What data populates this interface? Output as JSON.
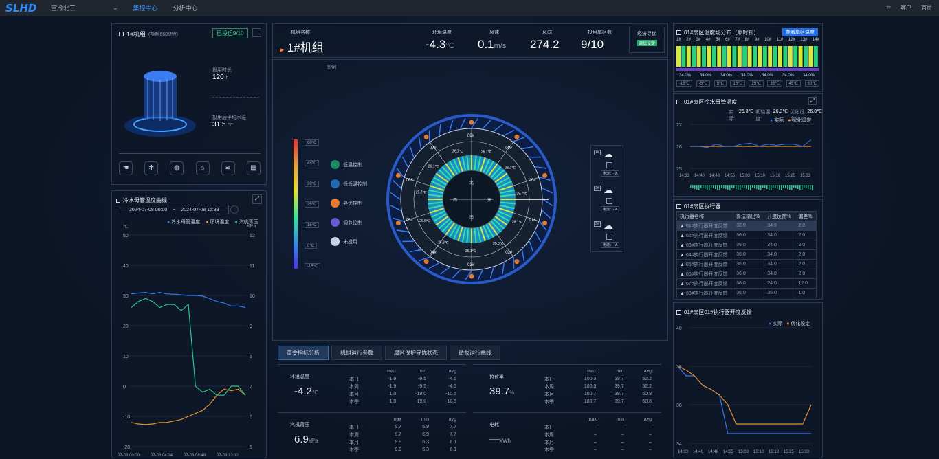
{
  "topbar": {
    "logo": "SLHD",
    "system": "空冷北三",
    "nav": [
      "集控中心",
      "分析中心"
    ],
    "right": [
      "客户",
      "首页"
    ]
  },
  "unit": {
    "title": "1#机组",
    "subtitle": "(额额660MW)",
    "status": "已投运9/10",
    "run_hours_label": "投用时长",
    "run_hours": "120",
    "run_hours_unit": "h",
    "avg_temp_label": "投用后平均水温",
    "avg_temp": "31.5",
    "avg_temp_unit": "℃"
  },
  "curve": {
    "title": "冷水母管温度曲线",
    "date_start": "2024-07-08 00:00",
    "date_sep": "~",
    "date_end": "2024-07-08 15:33",
    "legend": [
      "冷水母管温度",
      "环境温度",
      "汽机背压"
    ],
    "unit_left": "℃",
    "unit_right": "KPa",
    "x_ticks": [
      "07-08 00:00",
      "07-08 04:24",
      "07-08 08:48",
      "07-08 13:12"
    ]
  },
  "header": {
    "name_label": "机组名称",
    "name": "1#机组",
    "env_label": "环境温度",
    "env": "-4.3",
    "env_unit": "℃",
    "wind_label": "风速",
    "wind": "0.1",
    "wind_unit": "m/s",
    "dir_label": "风向",
    "dir": "274.2",
    "fans_label": "投用扇区数",
    "fans": "9/10",
    "opt_label": "经济寻优",
    "opt_btn": "调优设定",
    "legend_label": "图例"
  },
  "scale": [
    "60℃",
    "45℃",
    "30℃",
    "25℃",
    "15℃",
    "0℃",
    "-15℃"
  ],
  "modes": [
    "低温控制",
    "低低温控制",
    "寻优控制",
    "调节控制",
    "未投用"
  ],
  "ring": {
    "sectors": [
      "08#",
      "07#",
      "06#",
      "05#",
      "04#",
      "03#",
      "02#",
      "01#",
      "10#",
      "09#"
    ],
    "temps": [
      "26.1℃",
      "26.2℃",
      "25.7℃",
      "26.1℃",
      "25.8℃",
      "26.1℃",
      "26.3℃",
      "26.5℃",
      "25.7℃",
      "26.1℃",
      "26.2℃"
    ],
    "compass": [
      "北",
      "南",
      "西",
      "东"
    ]
  },
  "valves": [
    {
      "id": "1#",
      "label": "电流：- A"
    },
    {
      "id": "2#",
      "label": "电流：- A"
    },
    {
      "id": "3#",
      "label": "电流：- A"
    }
  ],
  "tabs": [
    "重要指标分析",
    "机组运行参数",
    "扇区保护寻优状态",
    "循泵运行曲线"
  ],
  "stats": {
    "headers": [
      "max",
      "min",
      "avg"
    ],
    "rows": [
      "本日",
      "本周",
      "本月",
      "本季"
    ],
    "env": {
      "label": "环境温度",
      "value": "-4.2",
      "unit": "℃",
      "data": [
        [
          "-1.9",
          "-9.5",
          "-4.5"
        ],
        [
          "-1.9",
          "-9.5",
          "-4.5"
        ],
        [
          "1.0",
          "-19.0",
          "-10.5"
        ],
        [
          "1.0",
          "-19.0",
          "-10.5"
        ]
      ]
    },
    "load": {
      "label": "负荷率",
      "value": "39.7",
      "unit": "%",
      "data": [
        [
          "100.3",
          "39.7",
          "52.2"
        ],
        [
          "100.3",
          "39.7",
          "52.2"
        ],
        [
          "100.7",
          "39.7",
          "60.8"
        ],
        [
          "100.7",
          "39.7",
          "60.8"
        ]
      ]
    },
    "back": {
      "label": "汽机背压",
      "value": "6.9",
      "unit": "kPa",
      "data": [
        [
          "9.7",
          "6.9",
          "7.7"
        ],
        [
          "9.7",
          "6.9",
          "7.7"
        ],
        [
          "9.9",
          "6.3",
          "8.1"
        ],
        [
          "9.9",
          "6.3",
          "8.1"
        ]
      ]
    },
    "power": {
      "label": "电耗",
      "value": "—",
      "unit": "kWh",
      "data": [
        [
          "–",
          "–",
          "–"
        ],
        [
          "–",
          "–",
          "–"
        ],
        [
          "–",
          "–",
          "–"
        ],
        [
          "–",
          "–",
          "–"
        ]
      ]
    }
  },
  "right": {
    "dist_title": "01#扇区温度场分布（顺时针）",
    "dist_btn": "查看扇区温度",
    "cols": [
      "1#",
      "2#",
      "3#",
      "4#",
      "5#",
      "6#",
      "7#",
      "8#",
      "9#",
      "10#",
      "11#",
      "12#",
      "13#",
      "14#"
    ],
    "pcts": [
      "34.0%",
      "34.0%",
      "34.0%",
      "34.0%",
      "34.0%",
      "34.0%",
      "34.0%"
    ],
    "scale": [
      "-15℃",
      "-5℃",
      "5℃",
      "15℃",
      "25℃",
      "35℃",
      "45℃",
      "60℃"
    ],
    "pipe_title": "01#扇区冷水母管温度",
    "pipe_actual_label": "实际:",
    "pipe_actual": "26.3℃",
    "pipe_init_label": "初始温度:",
    "pipe_init": "26.3℃",
    "pipe_opt_label": "优化设定:",
    "pipe_opt": "26.0℃",
    "legend": [
      "实际",
      "优化设定"
    ],
    "pipe_y": [
      "27",
      "26",
      "25"
    ],
    "pipe_x": [
      "14:33",
      "14:40",
      "14:48",
      "14:55",
      "15:03",
      "15:10",
      "15:18",
      "15:25",
      "15:33"
    ],
    "exec_title": "01#扇区执行器",
    "exec_headers": [
      "执行器名称",
      "算法输出%",
      "开度反馈%",
      "偏差%"
    ],
    "exec_rows": [
      [
        "01#执行器开度反馈",
        "36.0",
        "34.0",
        "2.0"
      ],
      [
        "02#执行器开度反馈",
        "36.0",
        "34.0",
        "2.0"
      ],
      [
        "03#执行器开度反馈",
        "36.0",
        "34.0",
        "2.0"
      ],
      [
        "04#执行器开度反馈",
        "36.0",
        "34.0",
        "2.0"
      ],
      [
        "05#执行器开度反馈",
        "36.0",
        "34.0",
        "2.0"
      ],
      [
        "06#执行器开度反馈",
        "36.0",
        "34.0",
        "2.0"
      ],
      [
        "07#执行器开度反馈",
        "36.0",
        "24.0",
        "12.0"
      ],
      [
        "08#执行器开度反馈",
        "36.0",
        "35.0",
        "1.0"
      ]
    ],
    "fb_title": "01#扇区01#执行器开度反馈",
    "fb_y": [
      "40",
      "38",
      "36",
      "34"
    ],
    "fb_x": [
      "14:33",
      "14:40",
      "14:48",
      "14:55",
      "15:03",
      "15:10",
      "15:18",
      "15:25",
      "15:33"
    ]
  },
  "chart_data": [
    {
      "type": "line",
      "series": [
        {
          "name": "冷水母管温度",
          "values": [
            30.5,
            30.8,
            31,
            30.5,
            31,
            30.5,
            30.4,
            30.2,
            30,
            30,
            29.8,
            29,
            28,
            27.5,
            26.5,
            26.5,
            26
          ]
        },
        {
          "name": "环境温度",
          "values": [
            -12,
            -12.5,
            -12.7,
            -12.5,
            -12,
            -12,
            -11.5,
            -11,
            -10,
            -9,
            -8,
            -6,
            -3,
            -1,
            -1.5,
            -1,
            -3
          ]
        },
        {
          "name": "汽机背压",
          "values": [
            9.6,
            9.8,
            9.9,
            9.8,
            9.6,
            9.7,
            9.7,
            9.5,
            9.7,
            7,
            6.8,
            6.9,
            6.7,
            6.7,
            7,
            7,
            6.7
          ]
        }
      ],
      "ylim": [
        -20,
        50
      ],
      "y2lim": [
        5,
        12
      ]
    },
    {
      "type": "line",
      "series": [
        {
          "name": "实际",
          "values": [
            26,
            26,
            25.95,
            26.1,
            26,
            26,
            26.1,
            26.15,
            26,
            26.1,
            26.05,
            26.1,
            26.1,
            26,
            26.3
          ]
        },
        {
          "name": "优化设定",
          "values": [
            26,
            26,
            26,
            26,
            26,
            26,
            26,
            26,
            26,
            26,
            26,
            26,
            26,
            26,
            26
          ]
        }
      ],
      "ylim": [
        25,
        27
      ]
    },
    {
      "type": "line",
      "series": [
        {
          "name": "实际",
          "values": [
            38,
            37.5,
            37.5,
            37,
            36.8,
            36.5,
            34.5,
            34.5,
            34.5,
            34.5,
            34.5,
            34.5,
            34.5,
            34.5,
            34.5,
            34.5,
            34.5
          ]
        },
        {
          "name": "优化设定",
          "values": [
            38,
            37.8,
            37.5,
            37,
            36.8,
            36.5,
            36,
            35,
            35,
            35,
            35,
            35,
            35,
            35,
            35,
            35,
            36
          ]
        }
      ],
      "ylim": [
        34,
        40
      ]
    }
  ]
}
